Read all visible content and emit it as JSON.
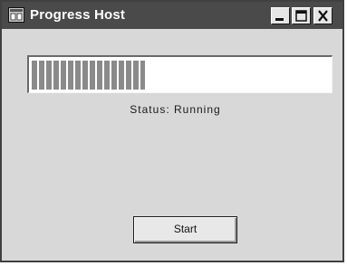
{
  "window": {
    "title": "Progress Host",
    "icon": "app-window-icon",
    "controls": {
      "minimize_icon": "minimize-icon",
      "maximize_icon": "maximize-icon",
      "close_icon": "close-icon"
    }
  },
  "progress": {
    "value": 0.38,
    "status_text": "Status: Running"
  },
  "actions": {
    "start_label": "Start"
  },
  "colors": {
    "titlebar": "#4a4a4a",
    "window_bg": "#d8d8d8",
    "progress_fill": "#8a8a8a"
  }
}
